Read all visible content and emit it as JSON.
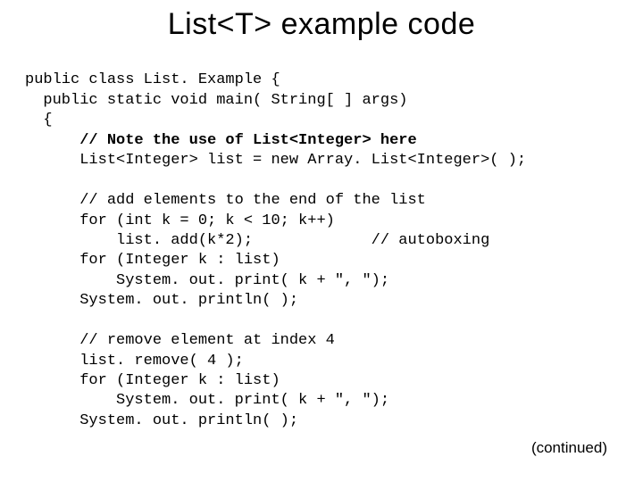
{
  "title": "List<T> example code",
  "code": {
    "l01": "public class List. Example {",
    "l02": "  public static void main( String[ ] args)",
    "l03": "  {",
    "l04": "      // Note the use of List<Integer> here",
    "l05": "      List<Integer> list = new Array. List<Integer>( );",
    "l06": "",
    "l07": "      // add elements to the end of the list",
    "l08": "      for (int k = 0; k < 10; k++)",
    "l09": "          list. add(k*2);             // autoboxing",
    "l10": "      for (Integer k : list)",
    "l11": "          System. out. print( k + \", \");",
    "l12": "      System. out. println( );",
    "l13": "",
    "l14": "      // remove element at index 4",
    "l15": "      list. remove( 4 );",
    "l16": "      for (Integer k : list)",
    "l17": "          System. out. print( k + \", \");",
    "l18": "      System. out. println( );"
  },
  "continued": "(continued)"
}
